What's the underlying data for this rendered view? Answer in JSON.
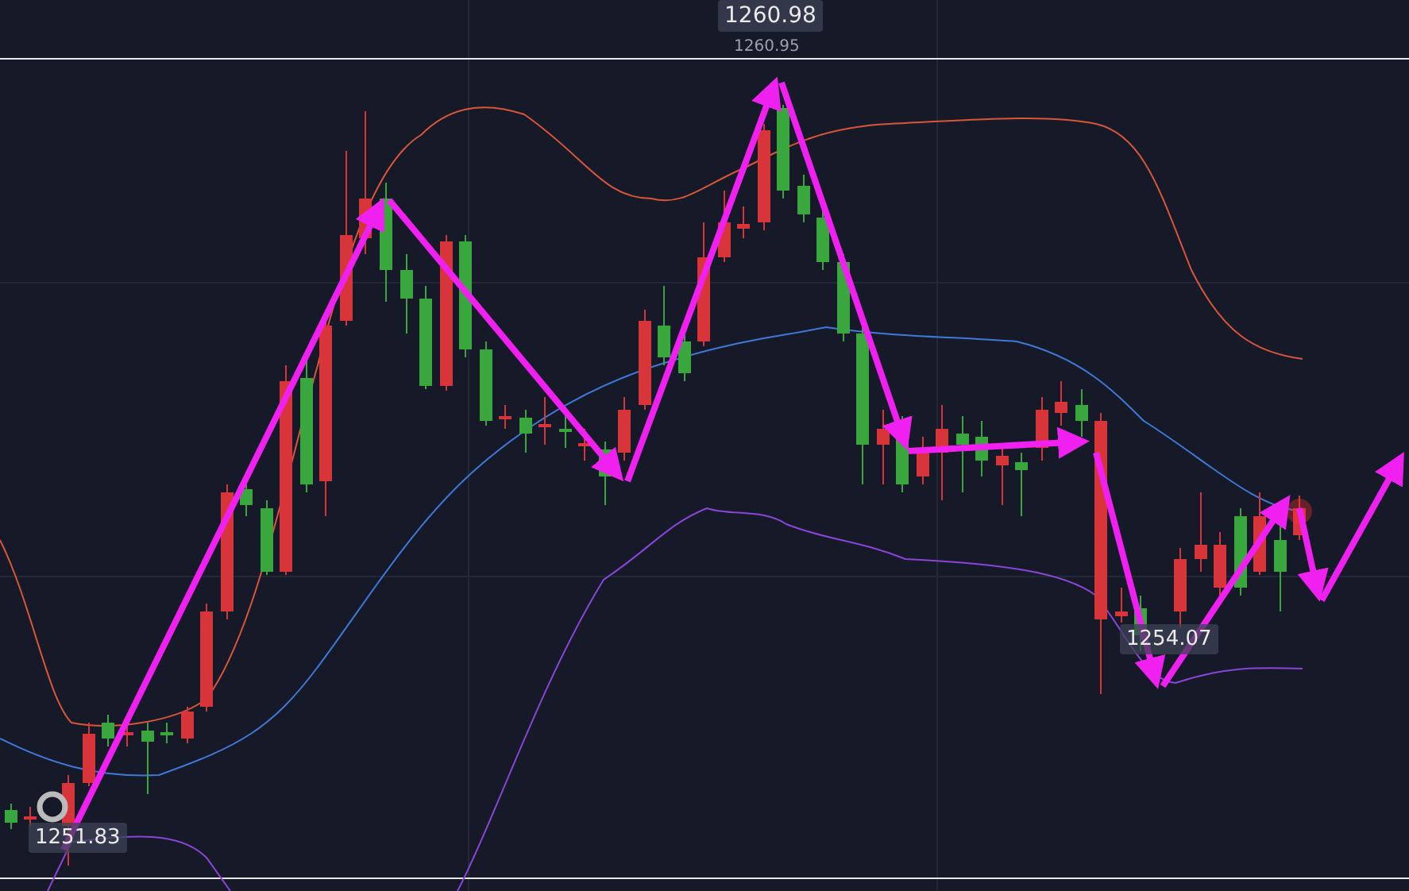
{
  "chart": {
    "high_price_tag": "1260.98",
    "high_price_note": "1260.95",
    "low_price_tags": [
      "1251.83",
      "1254.07"
    ]
  }
}
